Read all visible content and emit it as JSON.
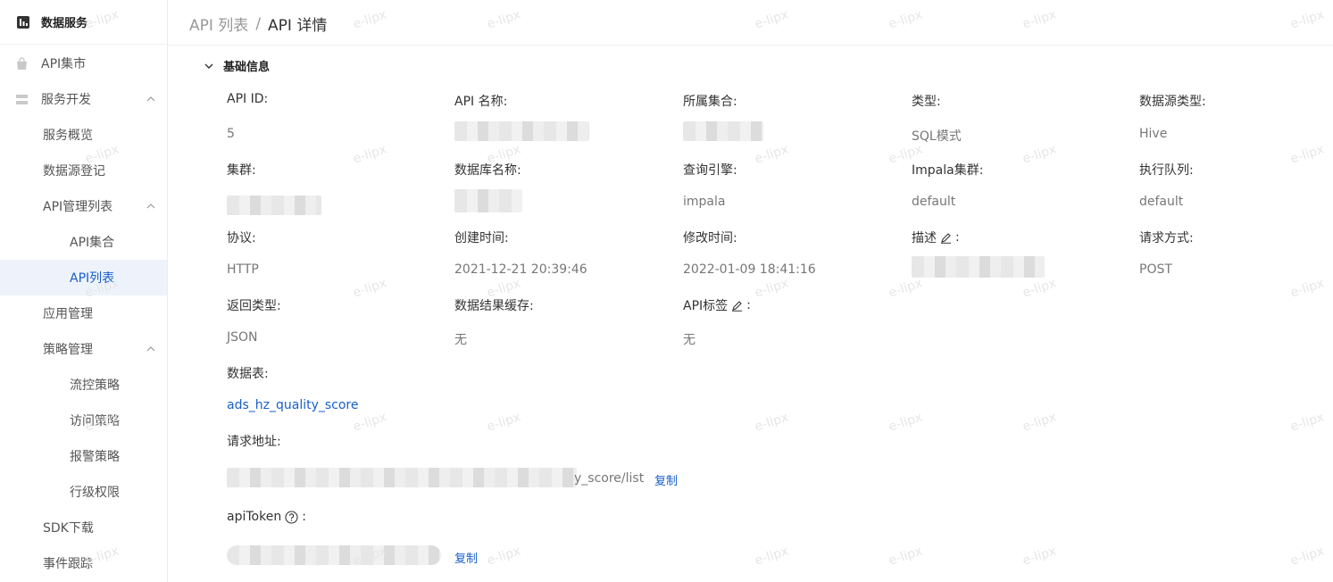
{
  "sidebar": {
    "brand": "数据服务",
    "items": [
      {
        "label": "API集市"
      },
      {
        "label": "服务开发"
      },
      {
        "label": "服务概览"
      },
      {
        "label": "数据源登记"
      },
      {
        "label": "API管理列表"
      },
      {
        "label": "API集合"
      },
      {
        "label": "API列表"
      },
      {
        "label": "应用管理"
      },
      {
        "label": "策略管理"
      },
      {
        "label": "流控策略"
      },
      {
        "label": "访问策略"
      },
      {
        "label": "报警策略"
      },
      {
        "label": "行级权限"
      },
      {
        "label": "SDK下载"
      },
      {
        "label": "事件跟踪"
      }
    ]
  },
  "breadcrumb": {
    "parent": "API 列表",
    "separator": "/",
    "current": "API 详情"
  },
  "section": {
    "title": "基础信息"
  },
  "fields": {
    "api_id": {
      "label": "API ID:",
      "value": "5"
    },
    "api_name": {
      "label": "API 名称:"
    },
    "collection": {
      "label": "所属集合:"
    },
    "type": {
      "label": "类型:",
      "value": "SQL模式"
    },
    "ds_type": {
      "label": "数据源类型:",
      "value": "Hive"
    },
    "cluster": {
      "label": "集群:"
    },
    "db_name": {
      "label": "数据库名称:"
    },
    "engine": {
      "label": "查询引擎:",
      "value": "impala"
    },
    "impala_cluster": {
      "label": "Impala集群:",
      "value": "default"
    },
    "queue": {
      "label": "执行队列:",
      "value": "default"
    },
    "protocol": {
      "label": "协议:",
      "value": "HTTP"
    },
    "created": {
      "label": "创建时间:",
      "value": "2021-12-21 20:39:46"
    },
    "modified": {
      "label": "修改时间:",
      "value": "2022-01-09 18:41:16"
    },
    "desc": {
      "label": "描述",
      "suffix": ":"
    },
    "method": {
      "label": "请求方式:",
      "value": "POST"
    },
    "return_type": {
      "label": "返回类型:",
      "value": "JSON"
    },
    "cache": {
      "label": "数据结果缓存:",
      "value": "无"
    },
    "tags": {
      "label": "API标签",
      "suffix": ":",
      "value": "无"
    },
    "table": {
      "label": "数据表:",
      "value": "ads_hz_quality_score"
    },
    "url": {
      "label": "请求地址:",
      "tail": "y_score/list",
      "copy": "复制"
    },
    "token": {
      "label": "apiToken",
      "suffix": ":",
      "copy": "复制"
    }
  },
  "watermark": "e-lipx",
  "colors": {
    "accent": "#1a5fc8",
    "active_bg": "#eef3fb"
  }
}
